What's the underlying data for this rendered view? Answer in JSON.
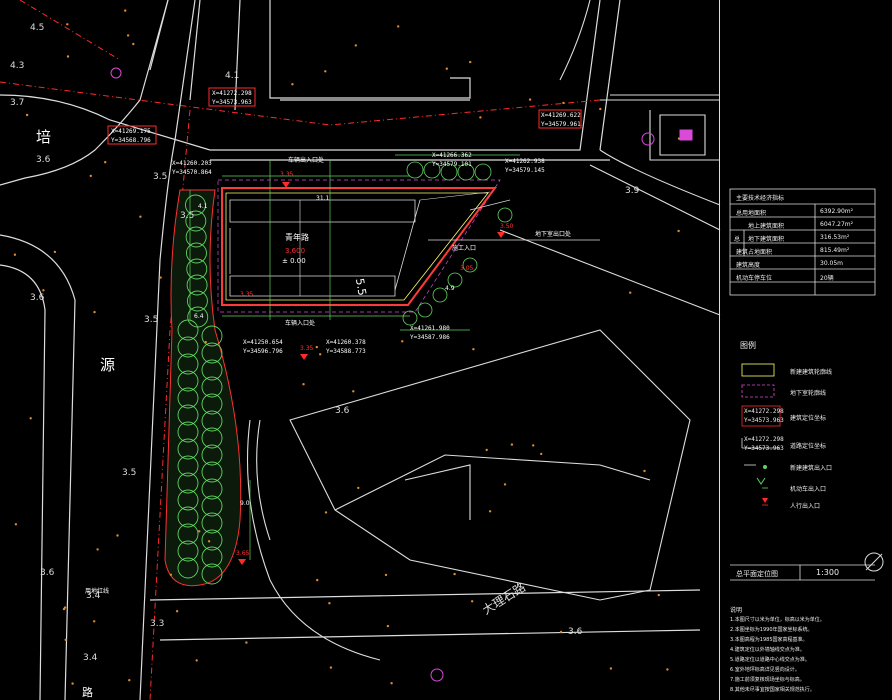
{
  "street_labels": {
    "pei": "培",
    "yuan": "源",
    "dali_road": "大理石路",
    "bottom_char": "路"
  },
  "elevations": [
    "4.5",
    "4.3",
    "3.7",
    "3.6",
    "3.5",
    "3.5",
    "3.5",
    "3.4",
    "3.5",
    "3.3",
    "3.4",
    "3.6",
    "3.6",
    "4.1",
    "3.9",
    "3.6",
    "3.6"
  ],
  "building": {
    "name": "青年路",
    "level_a": "3.600",
    "level_b": "± 0.00",
    "dims": [
      "31.1",
      "5.5",
      "6.4",
      "4.1",
      "4.9",
      "9.0"
    ],
    "entrance_top": "车辆出入口处",
    "entrance_bottom": "车辆入口处",
    "pedestrian_entry": "施工入口",
    "basement_line": "地下室出口处"
  },
  "coords": [
    "X=41272.298",
    "Y=34573.963",
    "X=41269.175",
    "Y=34568.796",
    "X=41269.622",
    "Y=34579.961",
    "X=41260.203",
    "Y=34570.864",
    "X=41266.362",
    "Y=34579.101",
    "X=41262.938",
    "Y=34579.145",
    "X=41261.980",
    "Y=34587.986",
    "X=41260.378",
    "Y=34588.773",
    "X=41250.654",
    "Y=34596.796"
  ],
  "levels_red": [
    "3.35",
    "3.50",
    "3.35",
    "3.35",
    "3.65",
    "3.05"
  ],
  "misc_labels": [
    "用地红线"
  ],
  "tech_table": {
    "title": "主要技术经济指标",
    "rows": [
      {
        "label": "总用地面积",
        "value": "6392.90m²"
      },
      {
        "label": "总",
        "value": "6047.27m²"
      },
      {
        "label": "地上建筑面积",
        "value": ""
      },
      {
        "label": "地下建筑面积",
        "value": "316.53m²"
      },
      {
        "label": "建筑占地面积",
        "value": "815.49m²"
      },
      {
        "label": "建筑高度",
        "value": "30.05m"
      },
      {
        "label": "机动车停车位",
        "value": "20辆"
      }
    ]
  },
  "legend": {
    "title": "图例",
    "items": [
      "新建建筑轮廓线",
      "地下室轮廓线",
      "建筑定位坐标",
      "道路定位坐标",
      "新建建筑出入口",
      "机动车出入口",
      "人行出入口"
    ]
  },
  "drawing": {
    "title": "总平面定位图",
    "scale": "1:300"
  },
  "notes": {
    "title": "说明",
    "lines": [
      "1.本图尺寸以米为单位，标高以米为单位。",
      "2.本图坐标为1990年国家坐标系统。",
      "3.本图高程为1985国家高程基准。",
      "4.建筑定位以外墙轴线交点为准。",
      "5.道路定位以道路中心线交点为准。",
      "6.室外地坪标高详见竖向设计。",
      "7.施工前须复核现场坐标与标高。",
      "8.其他未尽事宜按国家相关规范执行。"
    ]
  },
  "colors": {
    "background": "#000000",
    "red_line": "#ff2020",
    "green": "#5fd35f",
    "magenta": "#d94ad9",
    "yellow": "#ffff66",
    "white": "#ffffff"
  }
}
